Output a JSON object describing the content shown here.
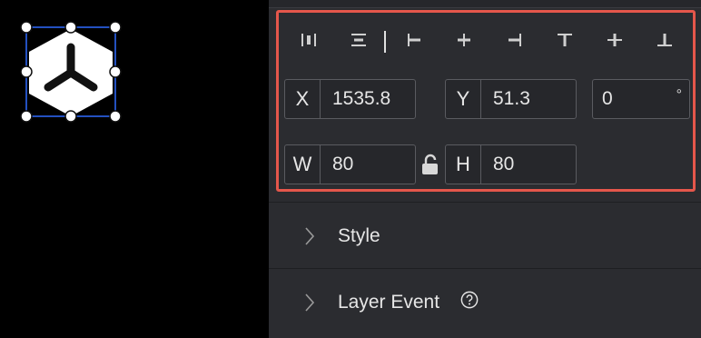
{
  "transform": {
    "x": {
      "label": "X",
      "value": "1535.8"
    },
    "y": {
      "label": "Y",
      "value": "51.3"
    },
    "rotation": {
      "value": "0",
      "unit": "°"
    },
    "w": {
      "label": "W",
      "value": "80"
    },
    "h": {
      "label": "H",
      "value": "80"
    }
  },
  "sections": {
    "style": "Style",
    "layer_event": "Layer Event"
  },
  "icons": {
    "align": [
      "distribute-horizontal-icon",
      "distribute-vertical-icon",
      "align-left-icon",
      "align-center-horizontal-icon",
      "align-right-icon",
      "align-top-icon",
      "align-middle-vertical-icon",
      "align-bottom-icon"
    ],
    "lock": "unlock-icon",
    "chevron": "chevron-right-icon",
    "help": "help-circle-icon"
  },
  "colors": {
    "highlight": "#e5574b",
    "selection": "#2f6bff",
    "panel": "#2b2c30"
  }
}
